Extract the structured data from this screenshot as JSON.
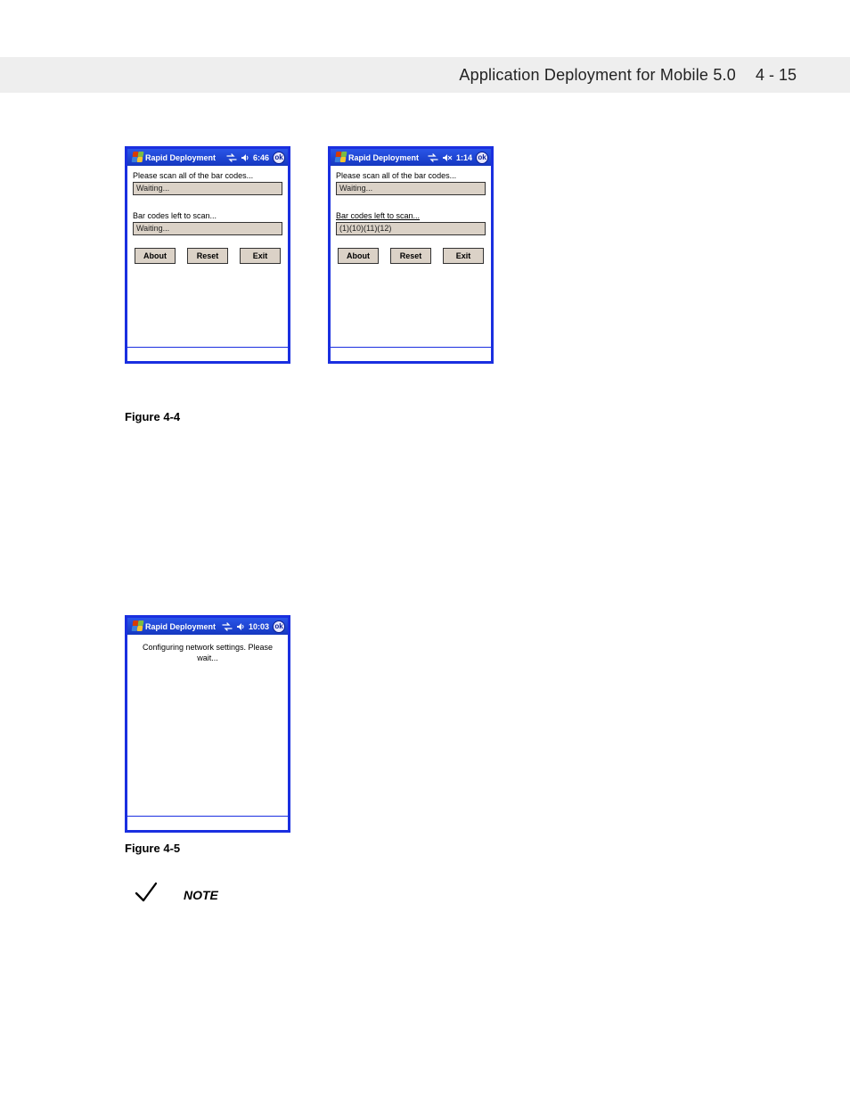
{
  "header": {
    "title": "Application Deployment for Mobile 5.0",
    "page": "4 - 15"
  },
  "figure44": {
    "caption": "Figure 4-4"
  },
  "figure45": {
    "caption": "Figure 4-5"
  },
  "note": {
    "label": "NOTE"
  },
  "ok_label": "ok",
  "buttons": {
    "about": "About",
    "reset": "Reset",
    "exit": "Exit"
  },
  "device1": {
    "title": "Rapid Deployment",
    "time": "6:46",
    "prompt": "Please scan all of the bar codes...",
    "field1": "Waiting...",
    "left_label": "Bar codes left to scan...",
    "field2": "Waiting..."
  },
  "device2": {
    "title": "Rapid Deployment",
    "time": "1:14",
    "prompt": "Please scan all of the bar codes...",
    "field1": "Waiting...",
    "left_label": "Bar codes left to scan...",
    "field2": "(1)(10)(11)(12)"
  },
  "device3": {
    "title": "Rapid Deployment",
    "time": "10:03",
    "message": "Configuring network settings.  Please wait..."
  }
}
